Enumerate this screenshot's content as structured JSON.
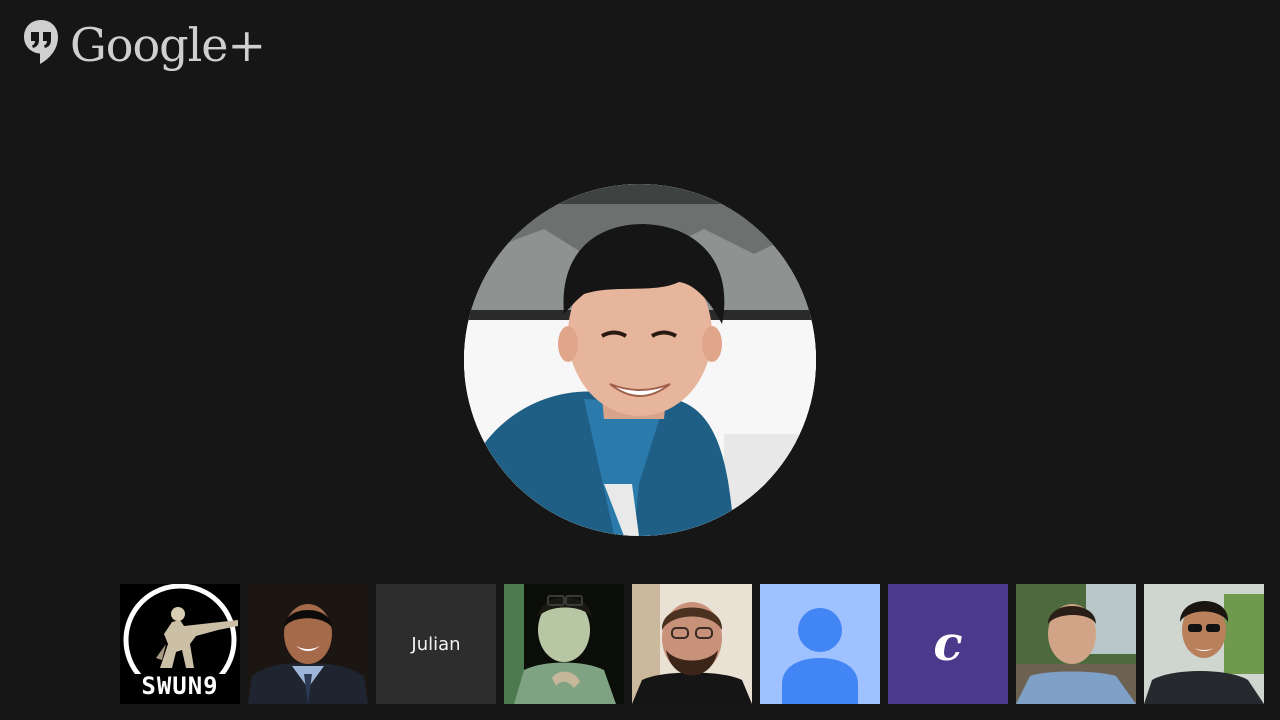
{
  "brand": {
    "name": "Google+",
    "icon": "hangouts-icon"
  },
  "main_speaker": {
    "type": "avatar-photo"
  },
  "participants": [
    {
      "type": "logo-image",
      "logo_text": "SWUN9"
    },
    {
      "type": "photo"
    },
    {
      "type": "name",
      "label": "Julian"
    },
    {
      "type": "photo"
    },
    {
      "type": "photo"
    },
    {
      "type": "default-avatar"
    },
    {
      "type": "initial",
      "initial": "c"
    },
    {
      "type": "photo"
    },
    {
      "type": "photo"
    }
  ],
  "colors": {
    "background": "#161616",
    "name_tile": "#2d2d2d",
    "default_avatar_bg": "#9fc1ff",
    "default_avatar_fg": "#4285f4",
    "initial_tile": "#4b3a8c"
  }
}
